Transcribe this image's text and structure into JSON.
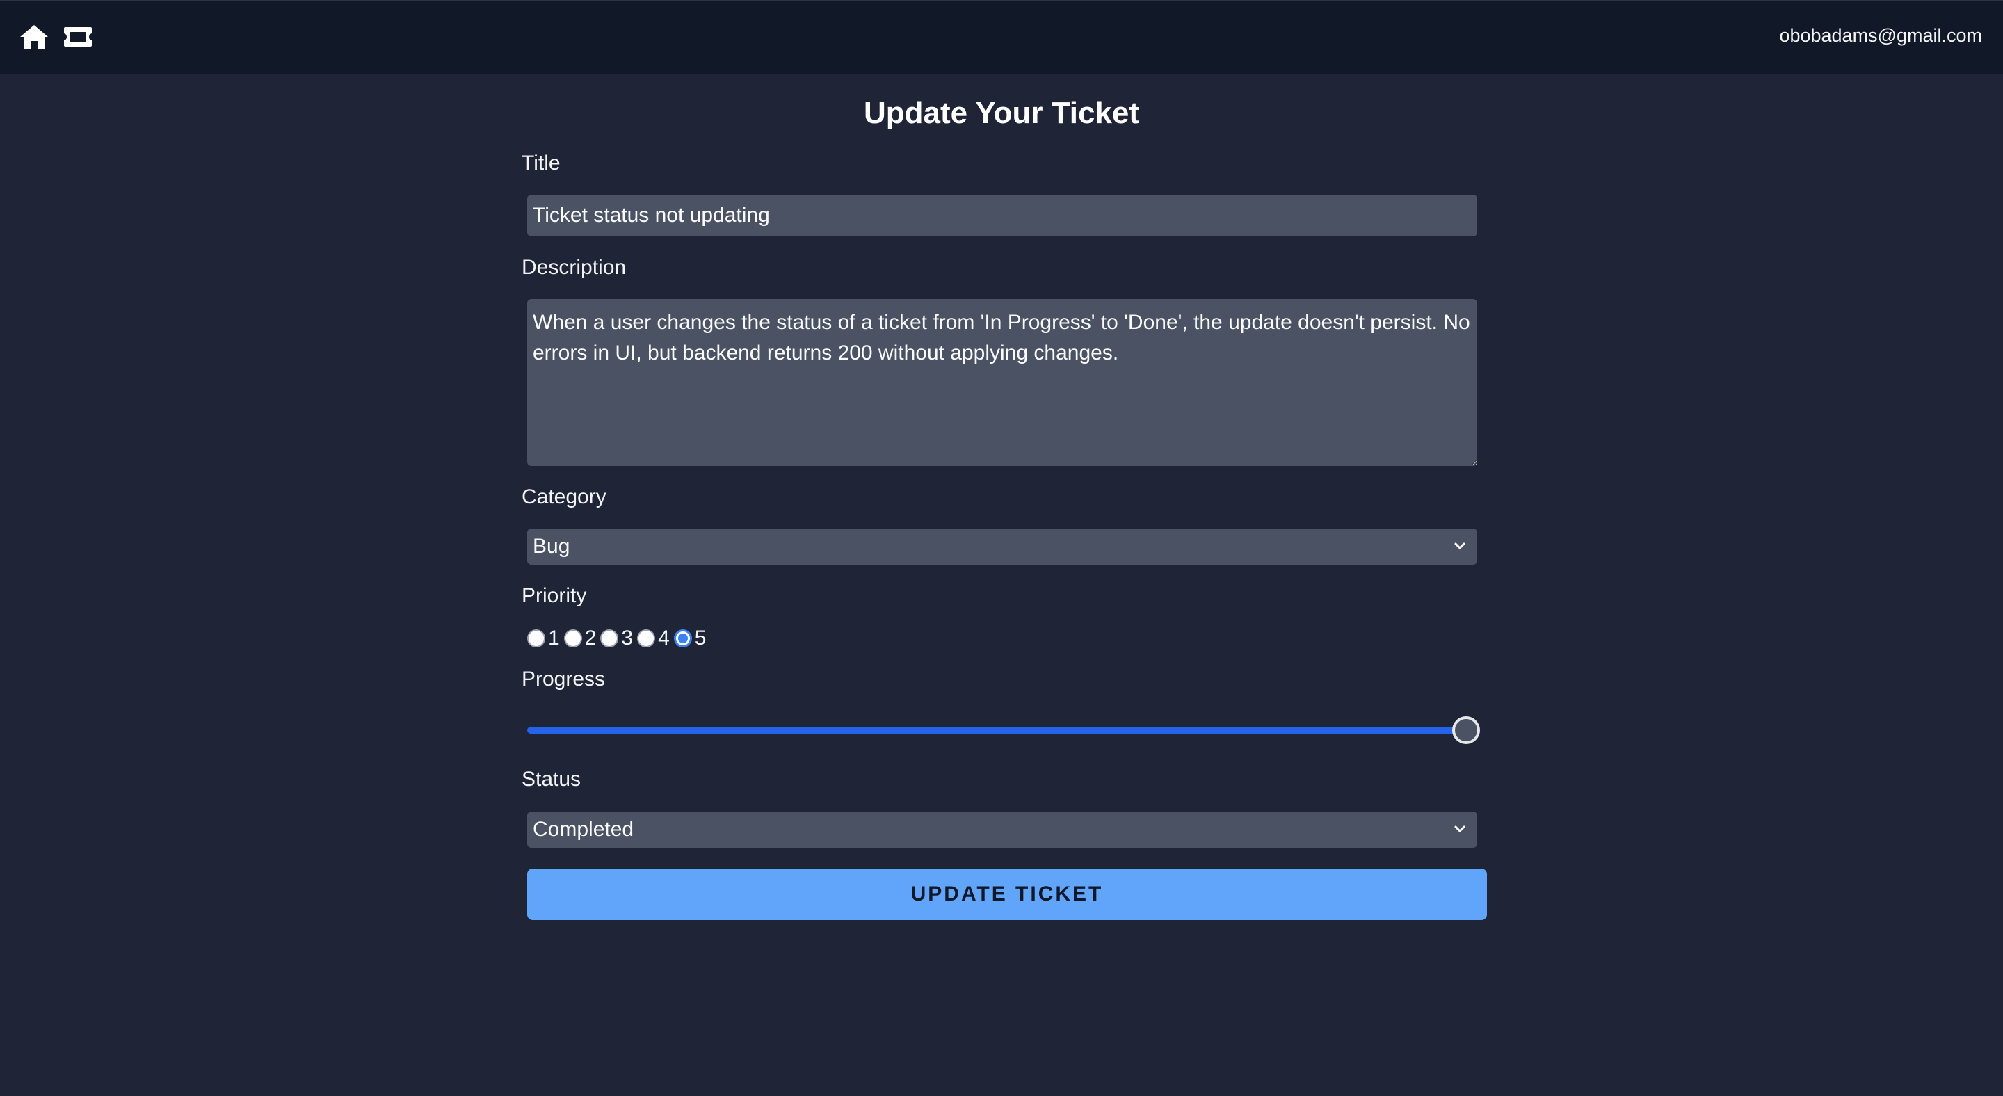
{
  "header": {
    "icons": [
      "home-icon",
      "ticket-icon"
    ],
    "user_email": "obobadams@gmail.com"
  },
  "form": {
    "heading": "Update Your Ticket",
    "title_label": "Title",
    "title_value": "Ticket status not updating",
    "description_label": "Description",
    "description_value": "When a user changes the status of a ticket from 'In Progress' to 'Done', the update doesn't persist. No errors in UI, but backend returns 200 without applying changes.",
    "category_label": "Category",
    "category_value": "Bug",
    "priority_label": "Priority",
    "priority_options": [
      "1",
      "2",
      "3",
      "4",
      "5"
    ],
    "priority_selected": "5",
    "progress_label": "Progress",
    "progress_value": 100,
    "status_label": "Status",
    "status_value": "Completed",
    "submit_label": "UPDATE TICKET"
  },
  "colors": {
    "background": "#1f2537",
    "topbar": "#111827",
    "field": "#4b5263",
    "accent": "#3b82f6",
    "button": "#60a5fa"
  }
}
